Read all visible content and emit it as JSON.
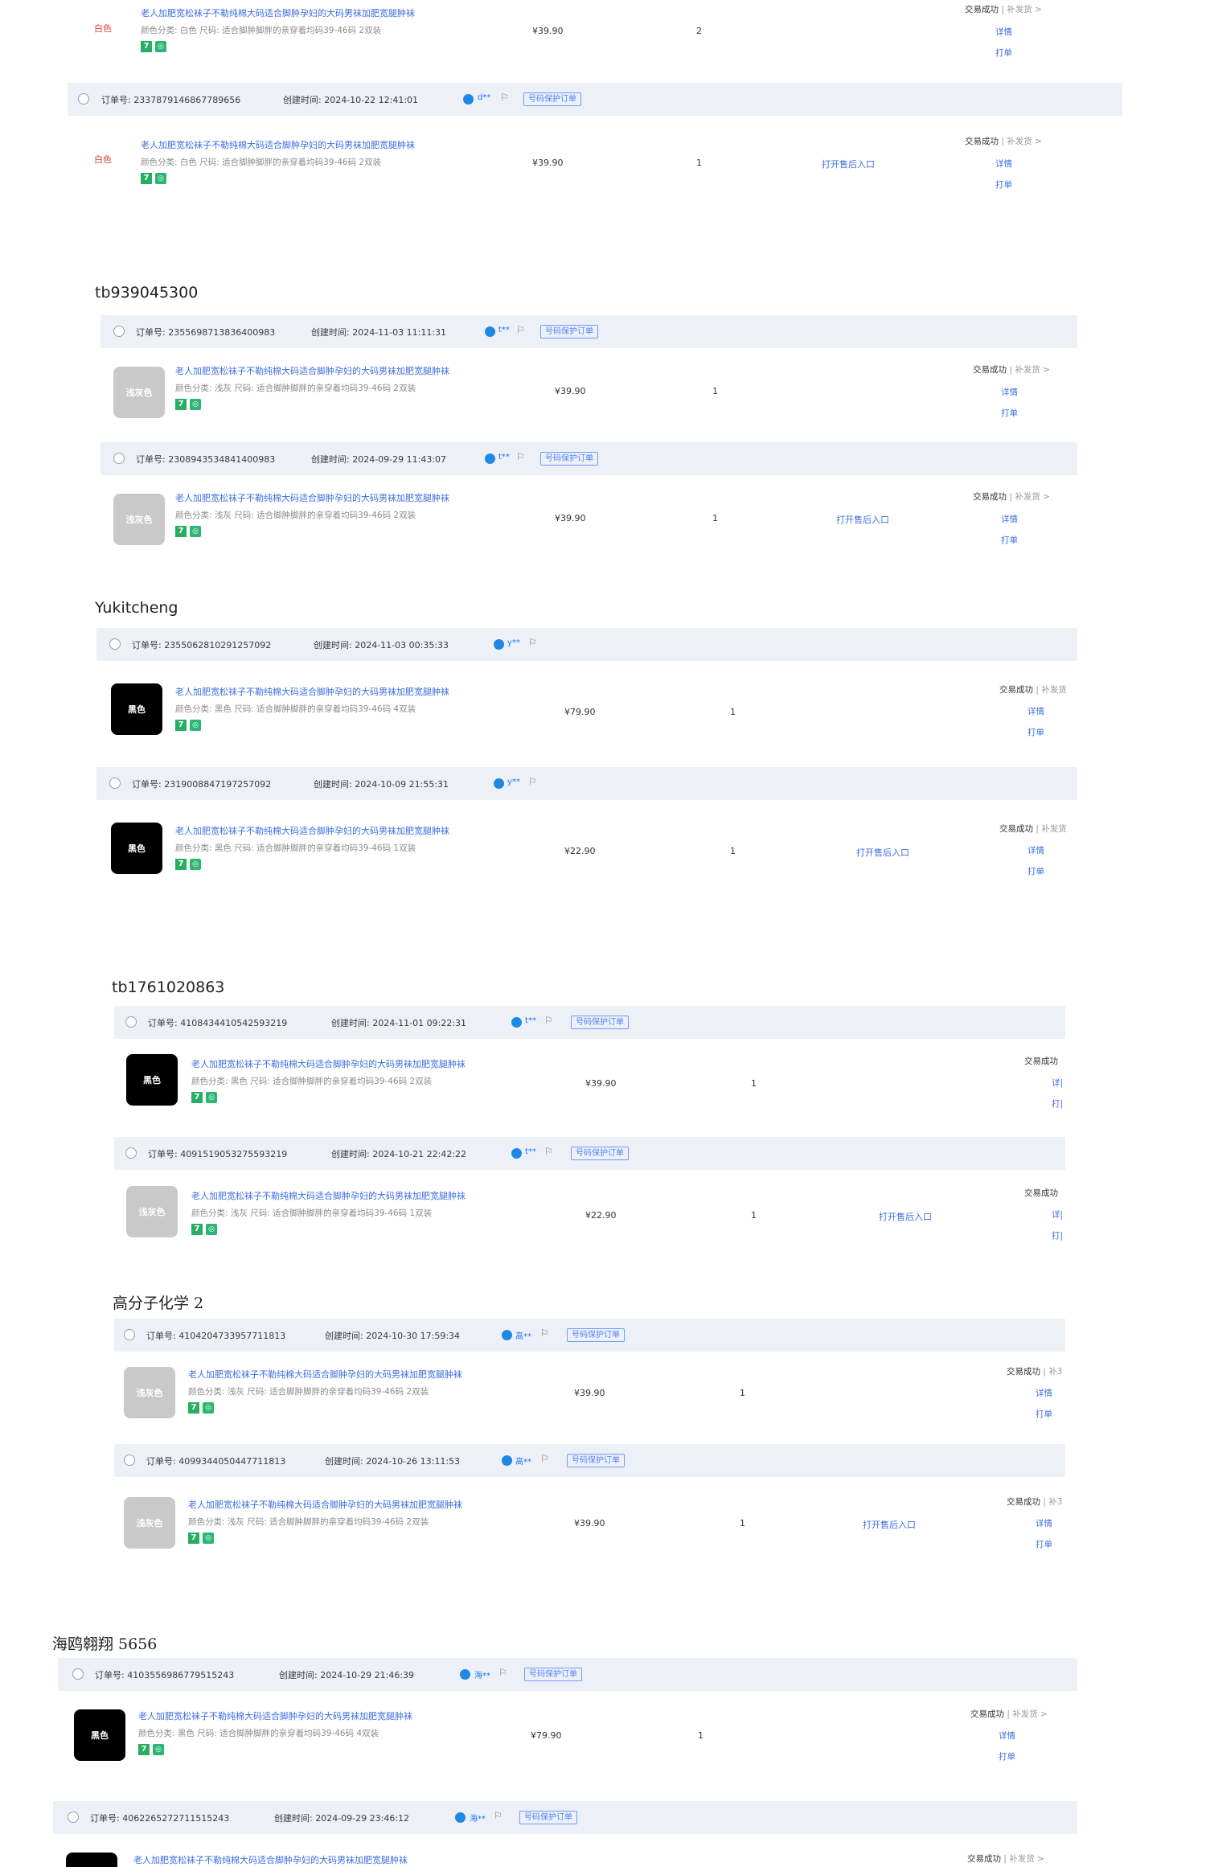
{
  "labels": {
    "order_no_prefix": "订单号:",
    "created_prefix": "创建时间:",
    "protect_badge": "号码保护订单",
    "status_text": "交易成功",
    "reissue_text": "补发货 >",
    "reissue_short": "补发货",
    "reissue_tiny": "补3",
    "details": "详情",
    "print": "打单",
    "details_cut": "详|",
    "print_cut": "打|",
    "aftersale": "打开售后入口",
    "product_title": "老人加肥宽松袜子不勒纯棉大码适合脚肿孕妇的大码男袜加肥宽腿肿袜",
    "red_color": "白色"
  },
  "shops": {
    "s1": "tb939045300",
    "s2": "Yukitcheng",
    "s3": "tb1761020863",
    "s4": "高分子化学 2",
    "s5": "海鸥翱翔 5656"
  },
  "orders": {
    "o1": {
      "price": "¥39.90",
      "qty": "2",
      "spec": "颜色分类: 白色  尺码: 适合脚肿脚胖的亲穿着均码39-46码 2双装"
    },
    "o2": {
      "no": "2337879146867789656",
      "time": "2024-10-22 12:41:01",
      "buyer": "d**",
      "price": "¥39.90",
      "qty": "1",
      "spec": "颜色分类: 白色  尺码: 适合脚肿脚胖的亲穿着均码39-46码 2双装"
    },
    "o3": {
      "no": "2355698713836400983",
      "time": "2024-11-03 11:11:31",
      "buyer": "t**",
      "thumb": "浅灰色",
      "price": "¥39.90",
      "qty": "1",
      "spec": "颜色分类: 浅灰  尺码: 适合脚肿脚胖的亲穿着均码39-46码 2双装"
    },
    "o4": {
      "no": "2308943534841400983",
      "time": "2024-09-29 11:43:07",
      "buyer": "t**",
      "thumb": "浅灰色",
      "price": "¥39.90",
      "qty": "1",
      "spec": "颜色分类: 浅灰  尺码: 适合脚肿脚胖的亲穿着均码39-46码 2双装"
    },
    "o5": {
      "no": "2355062810291257092",
      "time": "2024-11-03 00:35:33",
      "buyer": "y**",
      "thumb": "黑色",
      "price": "¥79.90",
      "qty": "1",
      "spec": "颜色分类: 黑色  尺码: 适合脚肿脚胖的亲穿着均码39-46码 4双装"
    },
    "o6": {
      "no": "2319008847197257092",
      "time": "2024-10-09 21:55:31",
      "buyer": "y**",
      "thumb": "黑色",
      "price": "¥22.90",
      "qty": "1",
      "spec": "颜色分类: 黑色  尺码: 适合脚肿脚胖的亲穿着均码39-46码 1双装"
    },
    "o7": {
      "no": "4108434410542593219",
      "time": "2024-11-01 09:22:31",
      "buyer": "t**",
      "thumb": "黑色",
      "price": "¥39.90",
      "qty": "1",
      "spec": "颜色分类: 黑色  尺码: 适合脚肿脚胖的亲穿着均码39-46码 2双装"
    },
    "o8": {
      "no": "4091519053275593219",
      "time": "2024-10-21 22:42:22",
      "buyer": "t**",
      "thumb": "浅灰色",
      "price": "¥22.90",
      "qty": "1",
      "spec": "颜色分类: 浅灰  尺码: 适合脚肿脚胖的亲穿着均码39-46码 1双装"
    },
    "o9": {
      "no": "4104204733957711813",
      "time": "2024-10-30 17:59:34",
      "buyer": "高**",
      "thumb": "浅灰色",
      "price": "¥39.90",
      "qty": "1",
      "spec": "颜色分类: 浅灰  尺码: 适合脚肿脚胖的亲穿着均码39-46码 2双装"
    },
    "o10": {
      "no": "4099344050447711813",
      "time": "2024-10-26 13:11:53",
      "buyer": "高**",
      "thumb": "浅灰色",
      "price": "¥39.90",
      "qty": "1",
      "spec": "颜色分类: 浅灰  尺码: 适合脚肿脚胖的亲穿着均码39-46码 2双装"
    },
    "o11": {
      "no": "4103556986779515243",
      "time": "2024-10-29 21:46:39",
      "buyer": "海**",
      "thumb": "黑色",
      "price": "¥79.90",
      "qty": "1",
      "spec": "颜色分类: 黑色  尺码: 适合脚肿脚胖的亲穿着均码39-46码 4双装"
    },
    "o12": {
      "no": "4062265272711515243",
      "time": "2024-09-29 23:46:12",
      "buyer": "海**",
      "thumb": "黑色"
    }
  }
}
